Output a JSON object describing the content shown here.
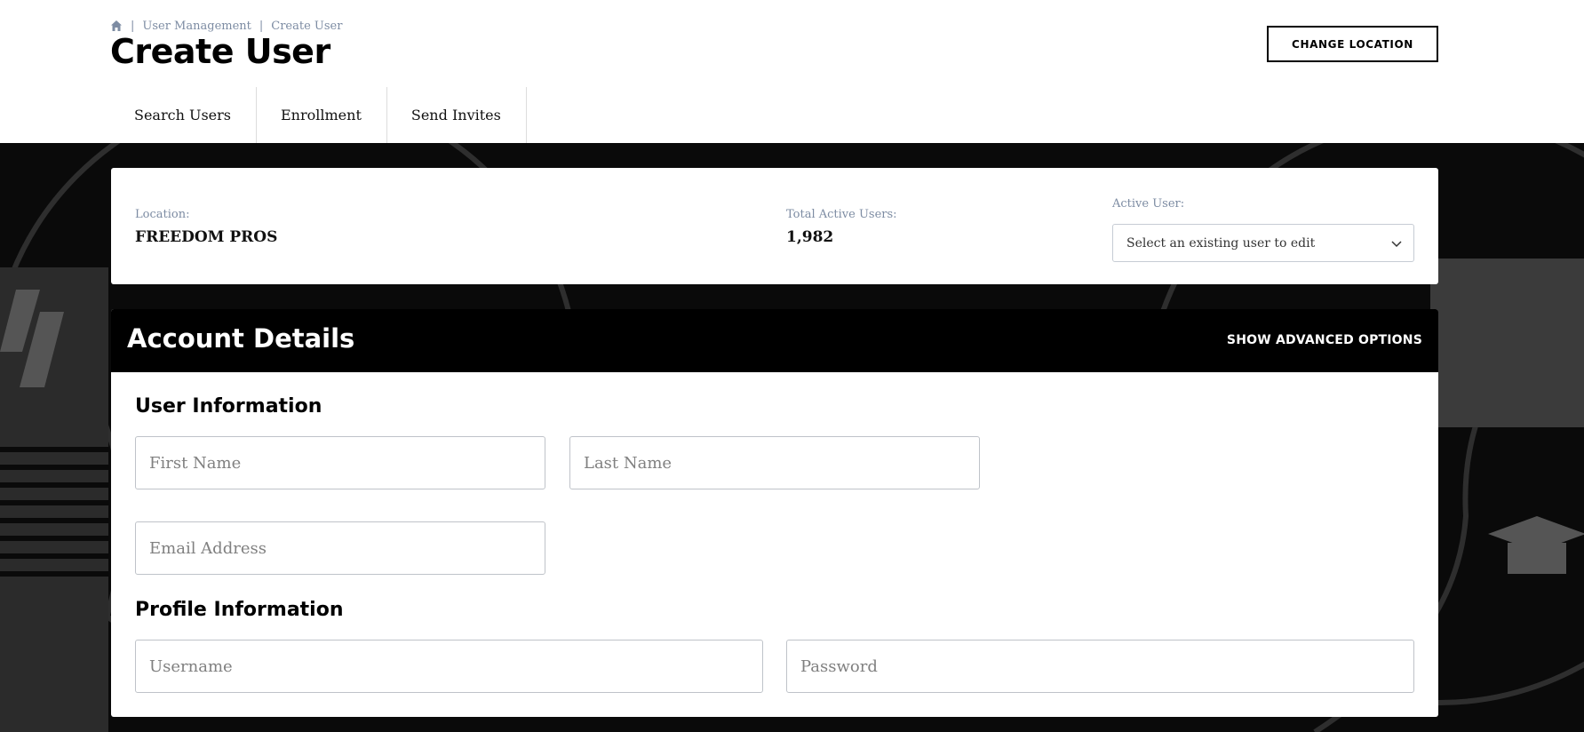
{
  "breadcrumb": {
    "home_icon": "home-icon",
    "items": [
      "User Management",
      "Create User"
    ],
    "separator": "|"
  },
  "header": {
    "title": "Create User",
    "change_location_label": "CHANGE LOCATION"
  },
  "tabs": [
    {
      "label": "Search Users"
    },
    {
      "label": "Enrollment"
    },
    {
      "label": "Send Invites"
    }
  ],
  "info": {
    "location_label": "Location:",
    "location_value": "FREEDOM PROS",
    "total_label": "Total Active Users:",
    "total_value": "1,982",
    "active_user_label": "Active User:",
    "active_user_placeholder": "Select an existing user to edit"
  },
  "account": {
    "title": "Account Details",
    "advanced_label": "SHOW ADVANCED OPTIONS",
    "user_info_title": "User Information",
    "first_name_placeholder": "First Name",
    "last_name_placeholder": "Last Name",
    "email_placeholder": "Email Address",
    "profile_info_title": "Profile Information",
    "username_placeholder": "Username",
    "password_placeholder": "Password"
  },
  "colors": {
    "accent_muted": "#7d8ca3",
    "background_dark": "#0a0a0a",
    "border": "#bfc3c9"
  }
}
